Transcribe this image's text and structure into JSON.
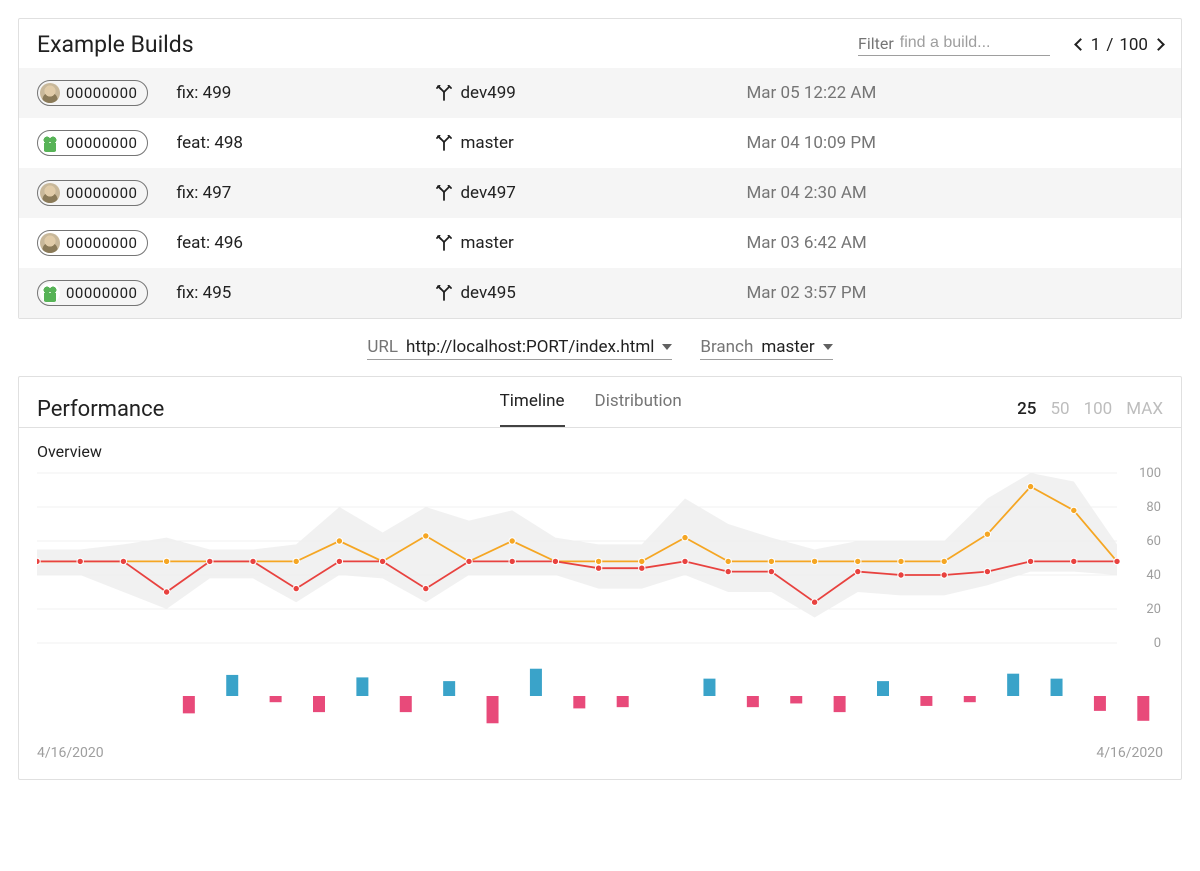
{
  "builds": {
    "title": "Example Builds",
    "filter_label": "Filter",
    "filter_placeholder": "find a build...",
    "pager": {
      "page": "1",
      "sep": "/",
      "total": "100"
    },
    "rows": [
      {
        "hash": "00000000",
        "avatar": "human",
        "title": "fix: 499",
        "branch": "dev499",
        "time": "Mar 05 12:22 AM"
      },
      {
        "hash": "00000000",
        "avatar": "robot",
        "title": "feat: 498",
        "branch": "master",
        "time": "Mar 04 10:09 PM"
      },
      {
        "hash": "00000000",
        "avatar": "human",
        "title": "fix: 497",
        "branch": "dev497",
        "time": "Mar 04 2:30 AM"
      },
      {
        "hash": "00000000",
        "avatar": "human",
        "title": "feat: 496",
        "branch": "master",
        "time": "Mar 03 6:42 AM"
      },
      {
        "hash": "00000000",
        "avatar": "robot",
        "title": "fix: 495",
        "branch": "dev495",
        "time": "Mar 02 3:57 PM"
      }
    ]
  },
  "selectors": {
    "url_label": "URL",
    "url_value": "http://localhost:PORT/index.html",
    "branch_label": "Branch",
    "branch_value": "master"
  },
  "perf": {
    "title": "Performance",
    "tabs": {
      "timeline": "Timeline",
      "distribution": "Distribution"
    },
    "ranges": {
      "r25": "25",
      "r50": "50",
      "r100": "100",
      "rmax": "MAX"
    },
    "overview_label": "Overview",
    "xaxis_left": "4/16/2020",
    "xaxis_right": "4/16/2020"
  },
  "chart_data": {
    "overview": {
      "type": "line",
      "ylim": [
        0,
        100
      ],
      "yticks": [
        0,
        20,
        40,
        60,
        80,
        100
      ],
      "series": [
        {
          "name": "orange",
          "color": "#f5a623",
          "values": [
            48,
            48,
            48,
            48,
            48,
            48,
            48,
            60,
            48,
            63,
            48,
            60,
            48,
            48,
            48,
            62,
            48,
            48,
            48,
            48,
            48,
            48,
            64,
            92,
            78,
            48
          ]
        },
        {
          "name": "red",
          "color": "#e8423f",
          "values": [
            48,
            48,
            48,
            30,
            48,
            48,
            32,
            48,
            48,
            32,
            48,
            48,
            48,
            44,
            44,
            48,
            42,
            42,
            24,
            42,
            40,
            40,
            42,
            48,
            48,
            48
          ]
        }
      ],
      "band": {
        "color": "#f1f1f1",
        "upper": [
          55,
          55,
          58,
          62,
          55,
          55,
          58,
          80,
          65,
          80,
          72,
          78,
          62,
          58,
          58,
          85,
          70,
          62,
          55,
          60,
          60,
          60,
          85,
          100,
          95,
          58
        ],
        "lower": [
          40,
          40,
          30,
          20,
          38,
          38,
          24,
          40,
          38,
          24,
          40,
          40,
          40,
          32,
          32,
          40,
          30,
          30,
          15,
          30,
          28,
          28,
          34,
          42,
          42,
          40
        ]
      }
    },
    "diff_bars": {
      "type": "bar",
      "series": [
        {
          "name": "blue",
          "color": "#3aa3c9",
          "values": [
            0,
            0,
            0,
            0,
            17,
            0,
            0,
            15,
            0,
            12,
            0,
            22,
            0,
            0,
            0,
            14,
            0,
            0,
            0,
            12,
            0,
            0,
            18,
            14,
            0,
            0
          ]
        },
        {
          "name": "pink",
          "color": "#e84a7a",
          "values": [
            0,
            0,
            0,
            14,
            0,
            5,
            13,
            0,
            13,
            0,
            22,
            0,
            10,
            9,
            0,
            0,
            9,
            6,
            13,
            0,
            8,
            5,
            0,
            0,
            12,
            20
          ]
        }
      ]
    }
  }
}
